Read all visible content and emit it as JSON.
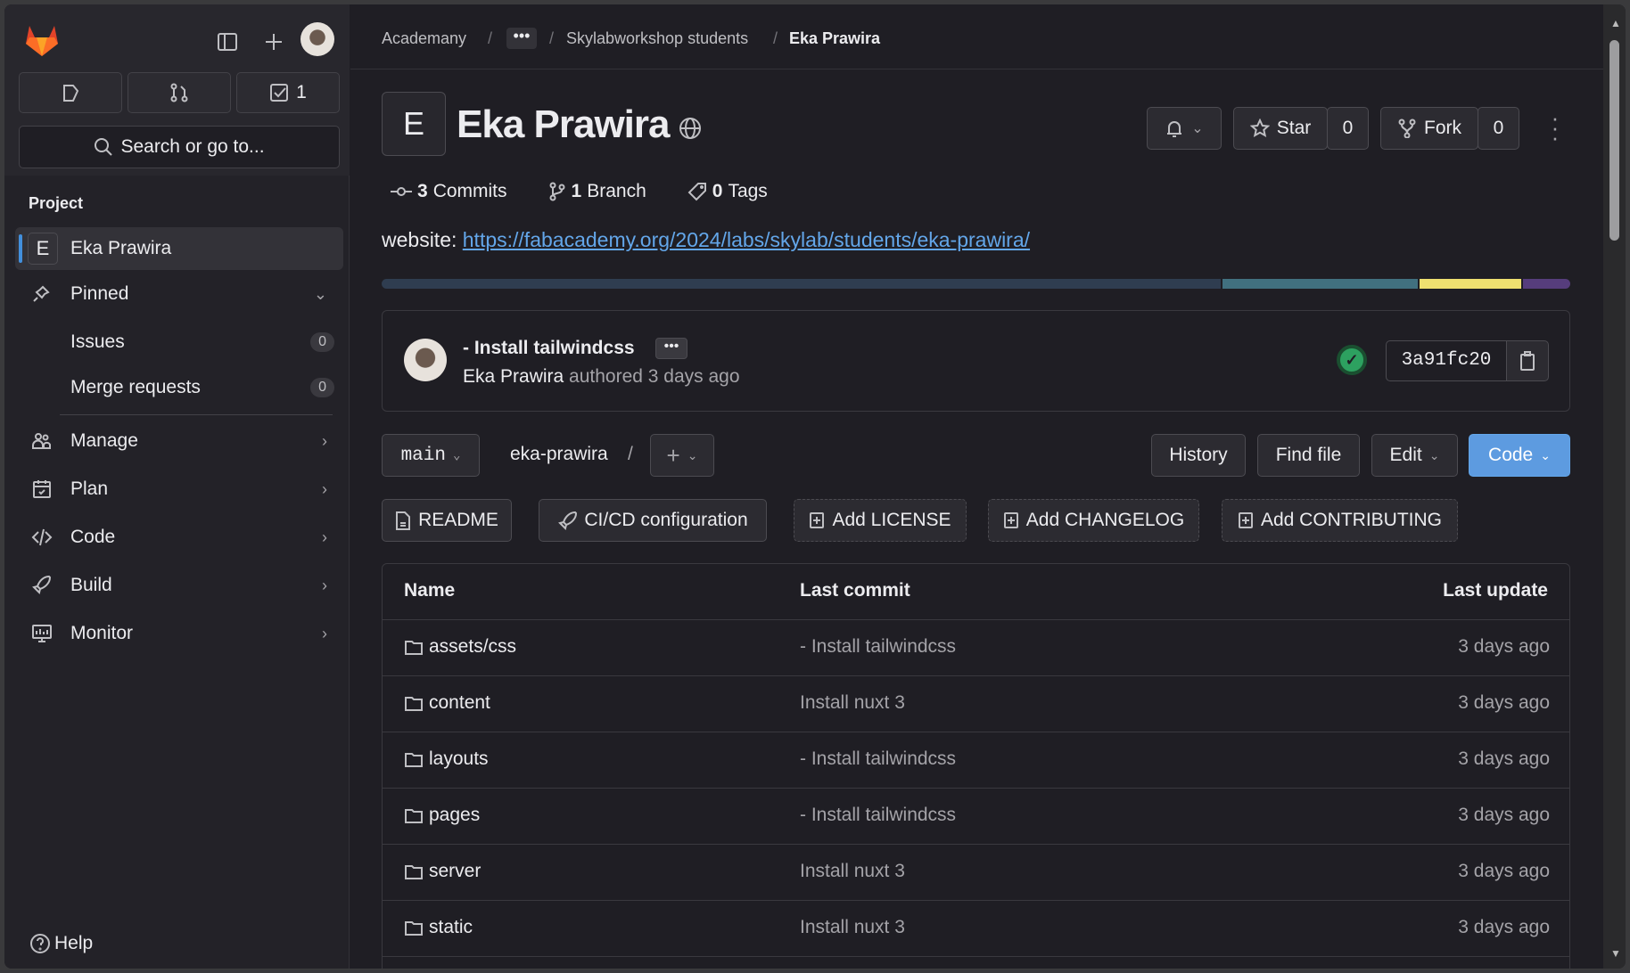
{
  "sidebar": {
    "todo_count": "1",
    "search_placeholder": "Search or go to...",
    "section": "Project",
    "project_initial": "E",
    "project_name": "Eka Prawira",
    "pinned": "Pinned",
    "issues": {
      "label": "Issues",
      "count": "0"
    },
    "merge_requests": {
      "label": "Merge requests",
      "count": "0"
    },
    "items": [
      {
        "label": "Manage",
        "icon": "users-icon"
      },
      {
        "label": "Plan",
        "icon": "calendar-icon"
      },
      {
        "label": "Code",
        "icon": "code-icon"
      },
      {
        "label": "Build",
        "icon": "rocket-icon"
      },
      {
        "label": "Monitor",
        "icon": "monitor-icon"
      }
    ],
    "help": "Help"
  },
  "breadcrumb": [
    "Academany",
    "Skylabworkshop students",
    "Eka Prawira"
  ],
  "project": {
    "initial": "E",
    "title": "Eka Prawira",
    "star_label": "Star",
    "star_count": "0",
    "fork_label": "Fork",
    "fork_count": "0",
    "commits_n": "3",
    "commits_label": "Commits",
    "branch_n": "1",
    "branch_label": "Branch",
    "tags_n": "0",
    "tags_label": "Tags",
    "website_label": "website:",
    "website_url": "https://fabacademy.org/2024/labs/skylab/students/eka-prawira/"
  },
  "languages": [
    {
      "color": "#2f3d50",
      "percent": 70.9
    },
    {
      "color": "#41707f",
      "percent": 16.5
    },
    {
      "color": "#efe070",
      "percent": 8.6
    },
    {
      "color": "#563d7c",
      "percent": 4.0
    }
  ],
  "commit": {
    "title": "- Install tailwindcss",
    "author": "Eka Prawira",
    "meta": "authored 3 days ago",
    "sha": "3a91fc20",
    "status": "passed",
    "status_color": "#2da160"
  },
  "repo": {
    "branch": "main",
    "path": "eka-prawira",
    "separator": "/",
    "history": "History",
    "find_file": "Find file",
    "edit": "Edit",
    "code": "Code",
    "accent": "#5d9be0"
  },
  "shortcuts": [
    "README",
    "CI/CD configuration",
    "Add LICENSE",
    "Add CHANGELOG",
    "Add CONTRIBUTING"
  ],
  "table": {
    "headers": [
      "Name",
      "Last commit",
      "Last update"
    ],
    "rows": [
      {
        "name": "assets/css",
        "commit": "- Install tailwindcss",
        "date": "3 days ago"
      },
      {
        "name": "content",
        "commit": "Install nuxt 3",
        "date": "3 days ago"
      },
      {
        "name": "layouts",
        "commit": "- Install tailwindcss",
        "date": "3 days ago"
      },
      {
        "name": "pages",
        "commit": "- Install tailwindcss",
        "date": "3 days ago"
      },
      {
        "name": "server",
        "commit": "Install nuxt 3",
        "date": "3 days ago"
      },
      {
        "name": "static",
        "commit": "Install nuxt 3",
        "date": "3 days ago"
      }
    ]
  }
}
